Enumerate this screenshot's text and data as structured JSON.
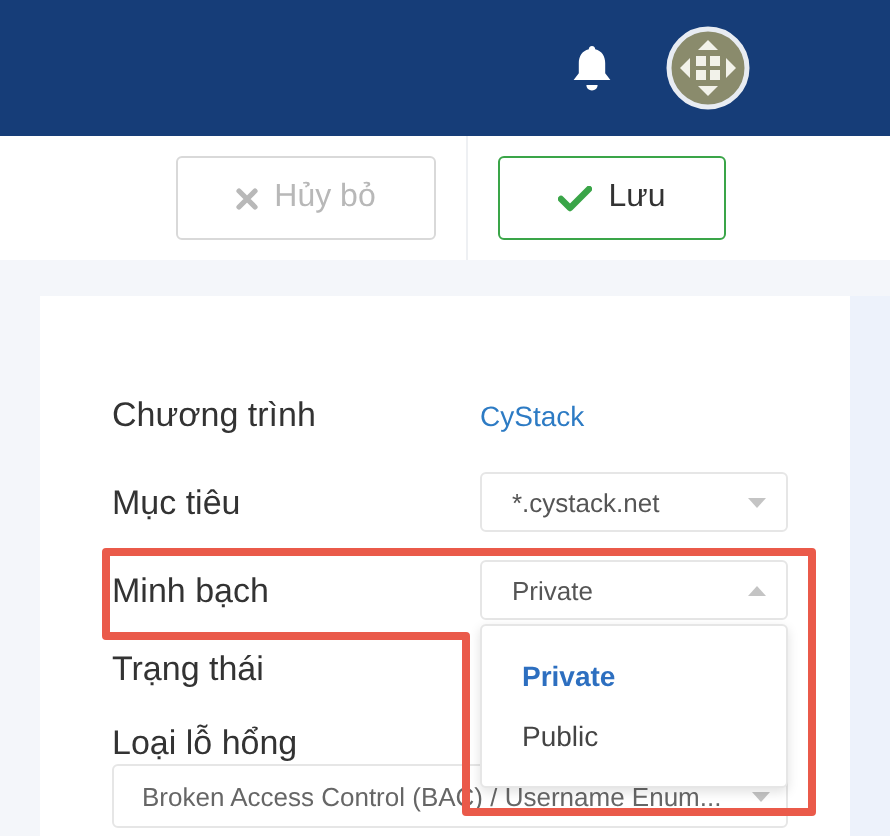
{
  "toolbar": {
    "buttons": [
      {
        "kind": "cancel",
        "label": "Hủy bỏ",
        "disabled": true
      },
      {
        "kind": "save",
        "label": "Lưu",
        "disabled": false
      }
    ]
  },
  "form": {
    "fields": [
      {
        "kind": "link",
        "label": "Chương trình",
        "value": "CyStack"
      },
      {
        "kind": "select",
        "label": "Mục tiêu",
        "value": "*.cystack.net",
        "expanded": false
      },
      {
        "kind": "select",
        "label": "Minh bạch",
        "value": "Private",
        "expanded": true,
        "options": [
          {
            "label": "Private",
            "selected": true
          },
          {
            "label": "Public",
            "selected": false
          }
        ]
      },
      {
        "kind": "label",
        "label": "Trạng thái"
      },
      {
        "kind": "wide-select",
        "label": "Loại lỗ hổng",
        "value": "Broken Access Control (BAC) / Username Enum..."
      }
    ]
  }
}
